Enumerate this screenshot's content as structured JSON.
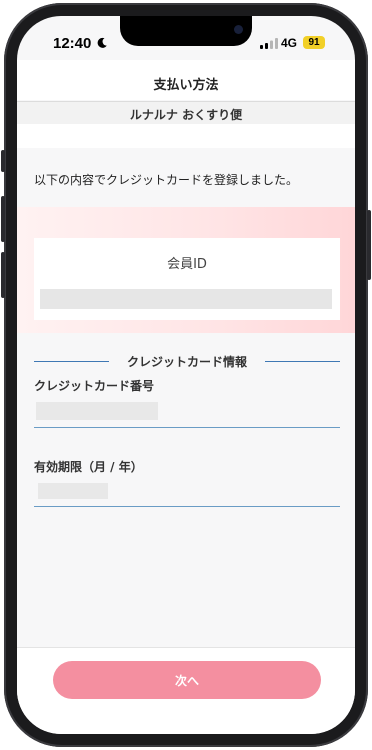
{
  "status_bar": {
    "time": "12:40",
    "network": "4G",
    "battery": "91",
    "icons": [
      "moon-icon",
      "signal-bars-icon"
    ],
    "battery_color": "#f2d028"
  },
  "header": {
    "title": "支払い方法"
  },
  "subheader": {
    "service_name": "ルナルナ おくすり便"
  },
  "main": {
    "message": "以下の内容でクレジットカードを登録しました。",
    "member": {
      "label": "会員ID",
      "value": ""
    },
    "card_section": {
      "title": "クレジットカード情報",
      "line_color": "#3f78b4",
      "card_number_label": "クレジットカード番号",
      "card_number_value": "",
      "expiry_label": "有効期限（月 / 年）",
      "expiry_value": ""
    }
  },
  "footer": {
    "next_label": "次へ",
    "button_color": "#f48fa0"
  }
}
